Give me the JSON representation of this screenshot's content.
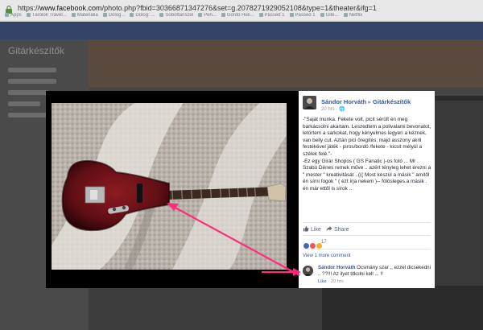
{
  "browser": {
    "url_protocol": "https://",
    "url_host": "www.facebook.com",
    "url_path": "/photo.php?fbid=30366871347276&set=g.2078271929052108&type=1&theater&ifg=1",
    "bookmarks": [
      "Apps",
      "Tárolók Travel...",
      "Materialia",
      "Dolog...",
      "Dolog: ...",
      "Sobottanszél",
      "Pen...",
      "Gordo Heli...",
      "Passed 1",
      "Passed 1",
      "Gite...",
      "Netflix"
    ]
  },
  "background": {
    "page_title": "Gitárkészítők"
  },
  "post": {
    "author": "Sándor Horváth",
    "arrow": "▸",
    "group": "Gitárkészítők",
    "time": "20 hrs · 🌐",
    "text": "-\"Saját munka. Fekete volt, picit sérült én meg barkácsolni akartam. Leszedtem a polivalami bevonatot, letörtem a sarkokat, hogy kényelmes legyen a kéznek, van belly cut. Aztán pici öregítés, majd asszony akril festékével játék - piros/bordó /fekete - kicsit mélyül a szélek felé.\"-\n-Ez egy Girár Shopos ( GS Fanatic )-os fotó ... Mr . Szabó Dénes remek műve .. azért tényleg lehet érezni a \" mester \" kreativitását ..((( Most készül a másik \" amitől én sírni fogok \" ( ezt írja nekem )-- fölösleges.a másik . én már ettől is sírok .."
  },
  "actions": {
    "like_label": "Like",
    "share_label": "Share"
  },
  "reactions": {
    "count": "17"
  },
  "comments": {
    "view_more": "View 1 more comment",
    "author": "Sándor Horváth",
    "text": "Ocsmány szar ,, ezzel dicsekedni .. ??!!! Az ilyet titkolni kell ... !!",
    "like_label": "Like",
    "time": "· 20 hrs"
  },
  "colors": {
    "annotation_arrow": "#ff2d7a",
    "fb_link": "#365899",
    "like_react": "#4267b2",
    "love_react": "#f25268",
    "haha_react": "#f7b125"
  }
}
